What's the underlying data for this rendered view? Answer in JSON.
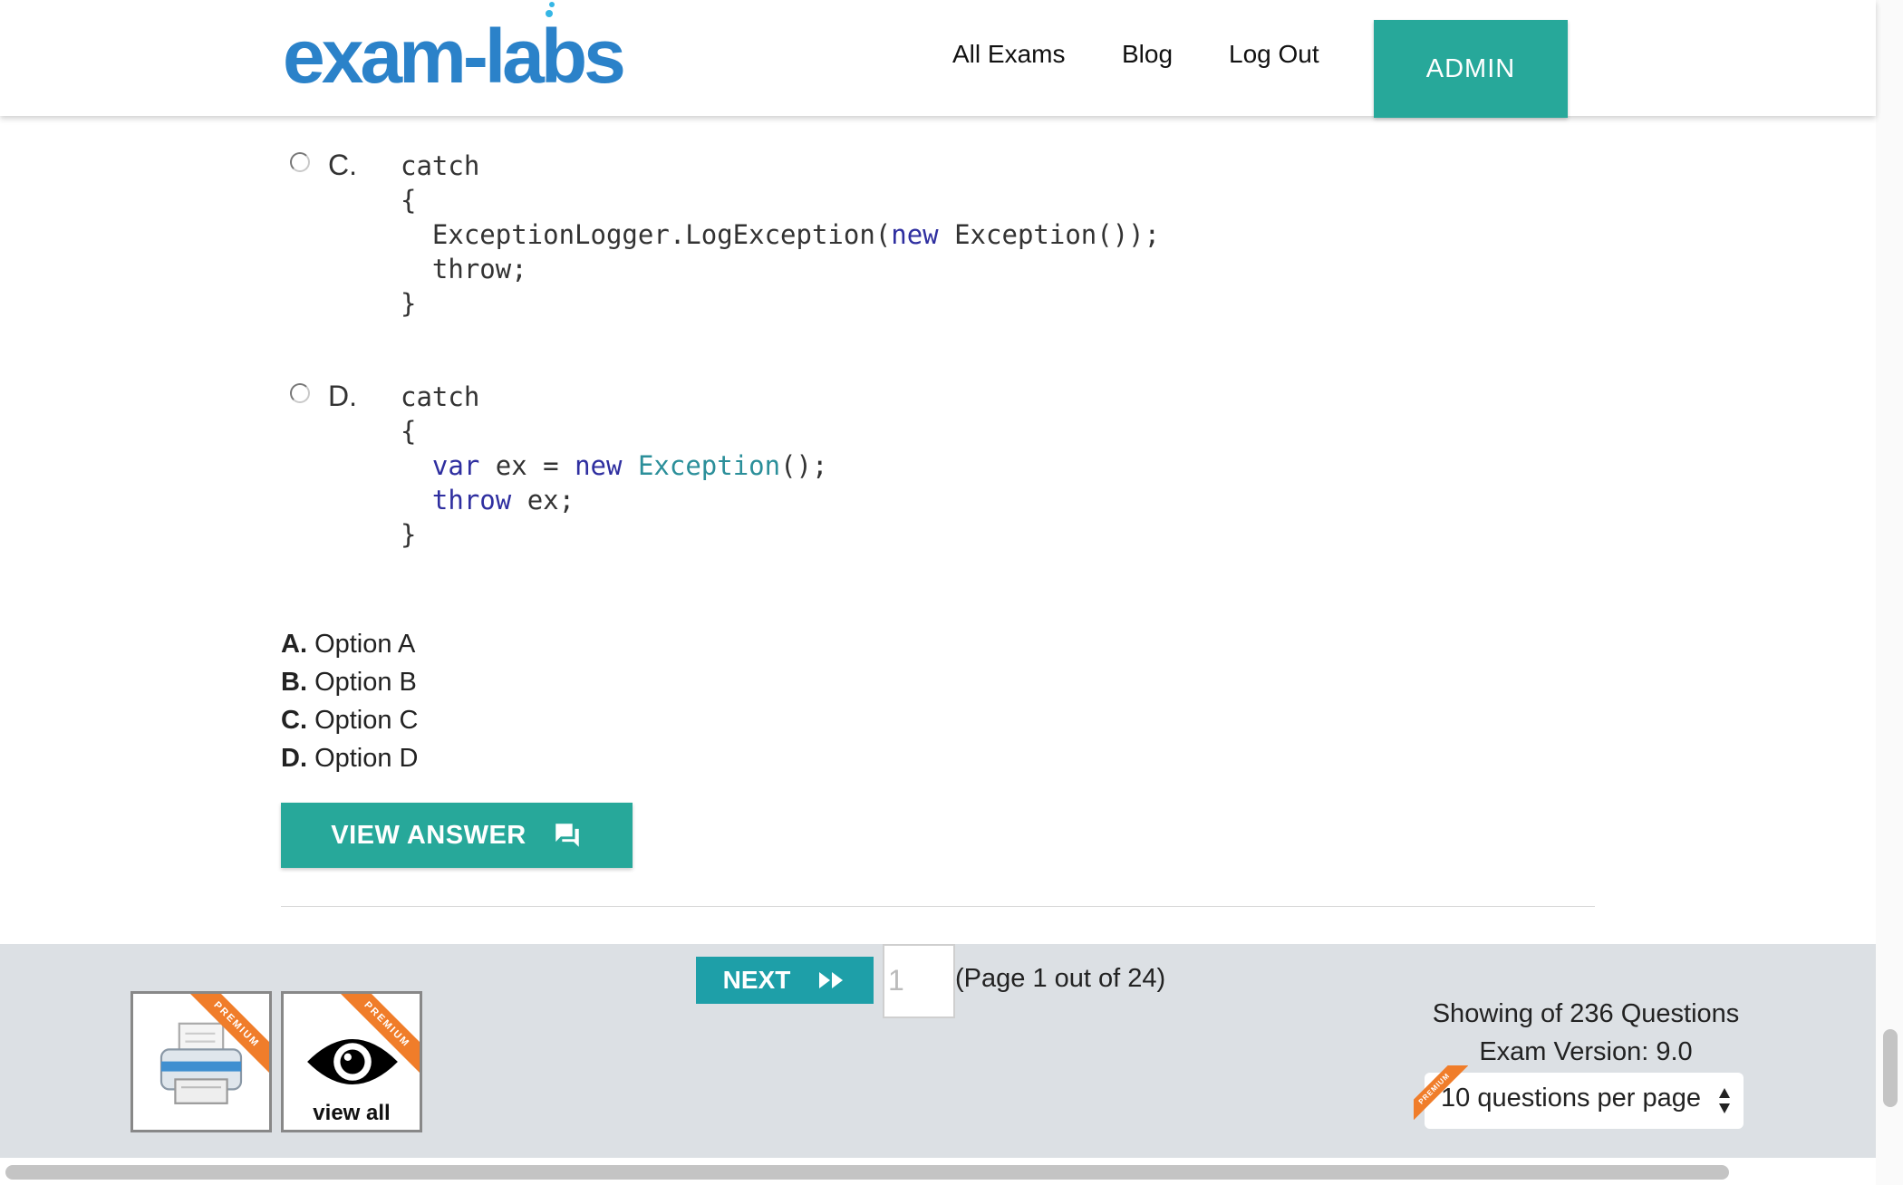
{
  "header": {
    "logo_text": "exam-labs",
    "nav": [
      "All Exams",
      "Blog",
      "Log Out"
    ],
    "admin_label": "ADMIN"
  },
  "options": {
    "c": {
      "letter": "C.",
      "lines": [
        "catch",
        "{",
        "  ExceptionLogger.LogException(new Exception());",
        "  throw;",
        "}"
      ]
    },
    "d": {
      "letter": "D.",
      "lines": [
        "catch",
        "{",
        "  var ex = new Exception();",
        "  throw ex;",
        "}"
      ]
    }
  },
  "answers": [
    {
      "letter": "A.",
      "text": "Option A"
    },
    {
      "letter": "B.",
      "text": "Option B"
    },
    {
      "letter": "C.",
      "text": "Option C"
    },
    {
      "letter": "D.",
      "text": "Option D"
    }
  ],
  "view_answer_label": "VIEW ANSWER",
  "footer": {
    "ribbon_label": "PREMIUM",
    "view_all_label": "view all",
    "next_label": "NEXT",
    "page_input_value": "1",
    "page_info": "(Page 1 out of 24)",
    "showing": "Showing of 236 Questions",
    "exam_version": "Exam Version: 9.0",
    "per_page": "10 questions per page"
  },
  "colors": {
    "accent": "#27a89a",
    "logo": "#2b82c9",
    "ribbon": "#f07d2a"
  },
  "icons": [
    "printer-icon",
    "eye-icon",
    "chat-icon",
    "fast-forward-icon"
  ]
}
